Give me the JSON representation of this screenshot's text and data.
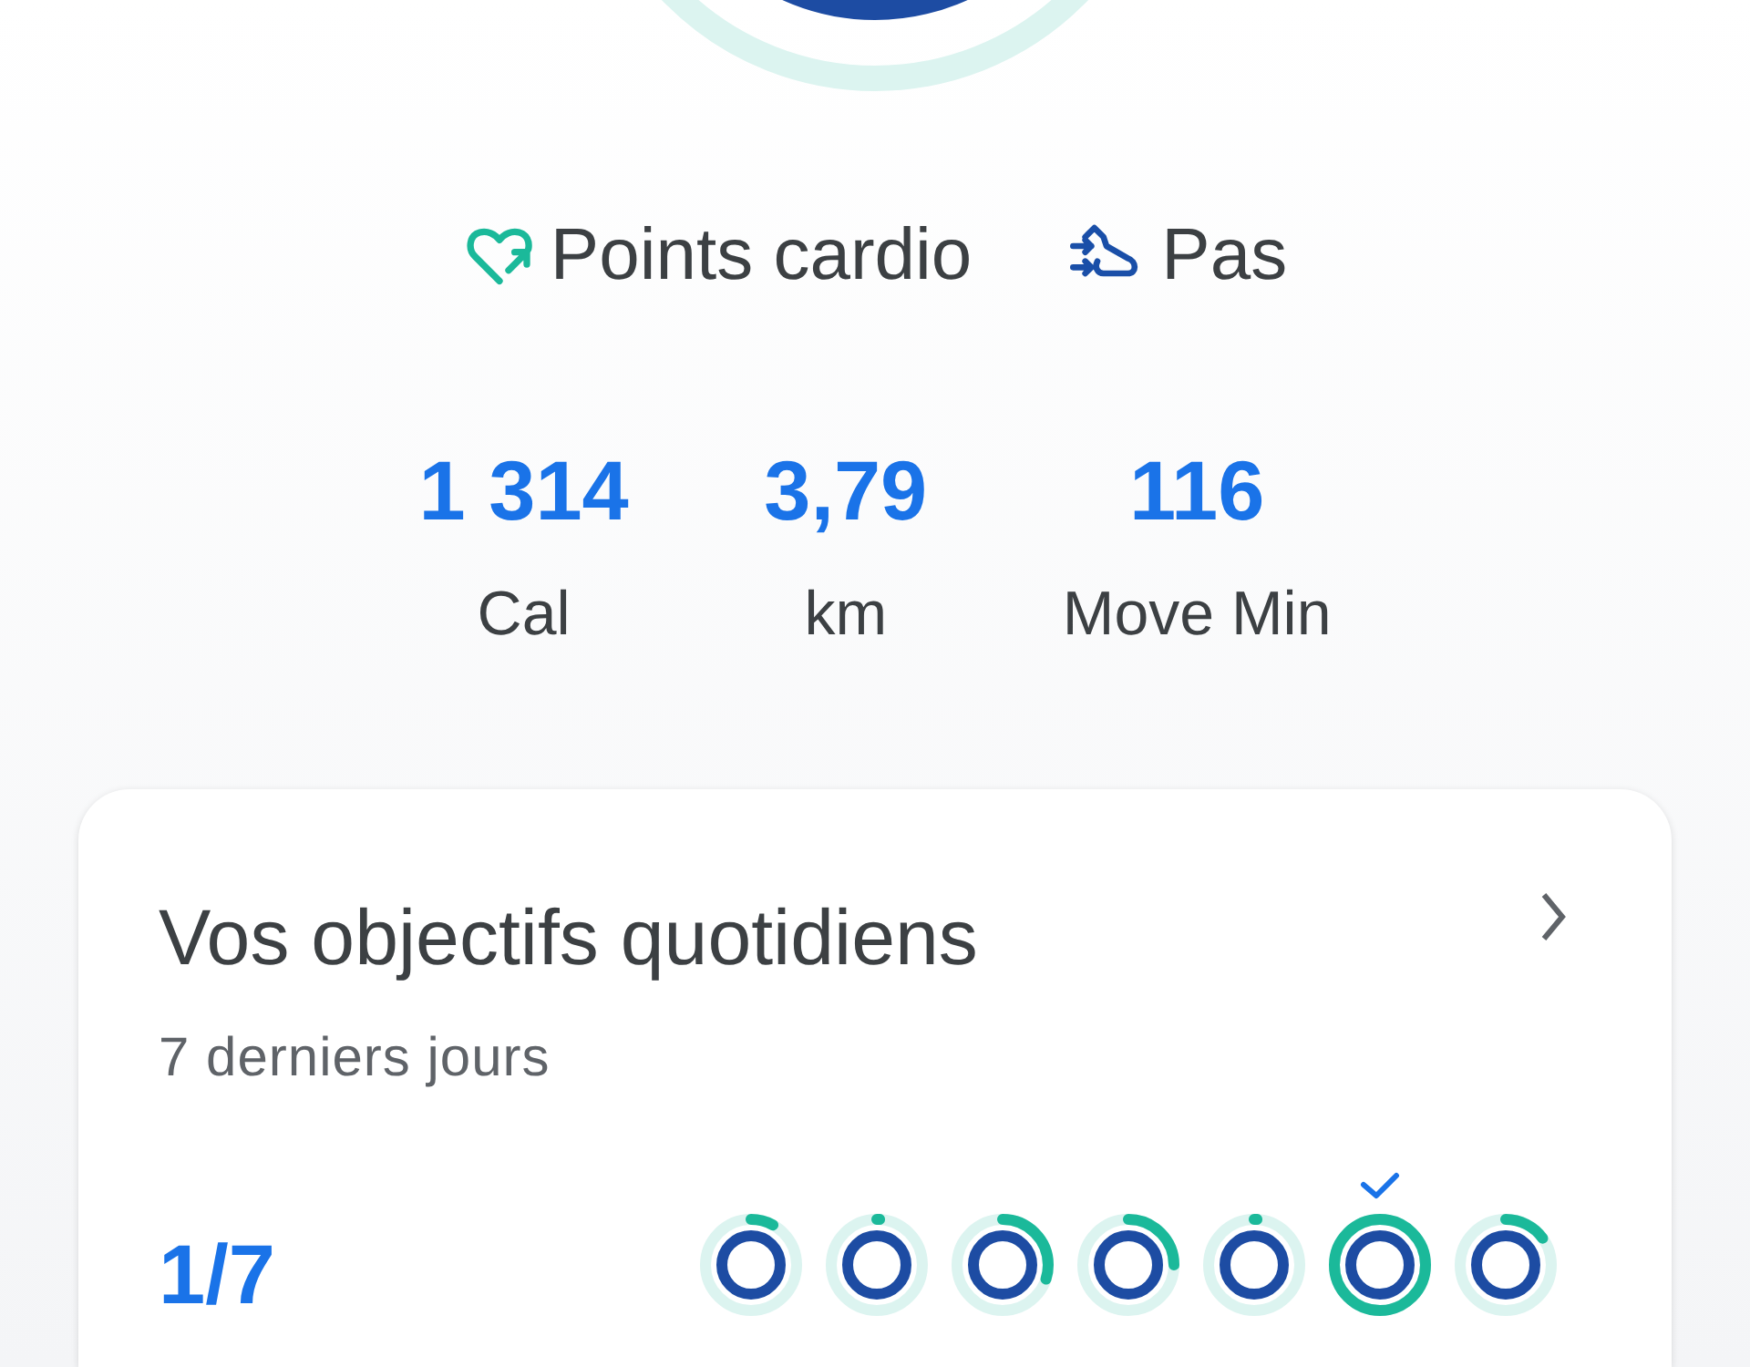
{
  "legend": [
    {
      "label": "Points cardio",
      "kind": "cardio"
    },
    {
      "label": "Pas",
      "kind": "steps"
    }
  ],
  "stats": [
    {
      "value": "1 314",
      "label": "Cal"
    },
    {
      "value": "3,79",
      "label": "km"
    },
    {
      "value": "116",
      "label": "Move Min"
    }
  ],
  "goals_card": {
    "title": "Vos objectifs quotidiens",
    "subtitle": "7 derniers jours",
    "summary": "1/7",
    "days": [
      {
        "goal_met": false
      },
      {
        "goal_met": false
      },
      {
        "goal_met": false
      },
      {
        "goal_met": false
      },
      {
        "goal_met": false
      },
      {
        "goal_met": true
      },
      {
        "goal_met": false
      }
    ]
  }
}
